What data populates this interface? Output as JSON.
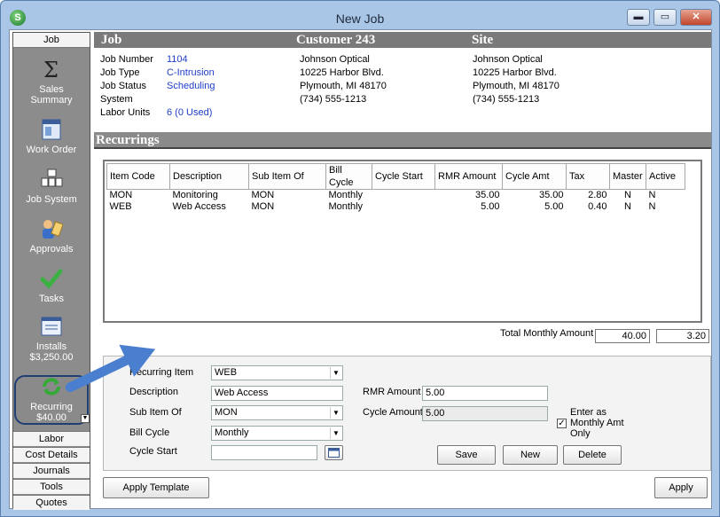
{
  "window": {
    "title": "New Job",
    "app_icon": "S",
    "min": "▬",
    "max": "▭",
    "close": "✕"
  },
  "nav": {
    "top": "Job",
    "items": [
      {
        "label": "Sales\nSummary"
      },
      {
        "label": "Work Order"
      },
      {
        "label": "Job System"
      },
      {
        "label": "Approvals"
      },
      {
        "label": "Tasks"
      },
      {
        "label": "Installs\n$3,250.00"
      },
      {
        "label": "Recurring\n$40.00"
      }
    ],
    "bottom": [
      "Labor",
      "Cost Details",
      "Journals",
      "Tools",
      "Quotes"
    ]
  },
  "header": {
    "job_heading": "Job",
    "customer_heading": "Customer 243",
    "site_heading": "Site",
    "fields": [
      {
        "label": "Job Number",
        "value": "1104"
      },
      {
        "label": "Job Type",
        "value": "C-Intrusion"
      },
      {
        "label": "Job Status",
        "value": "Scheduling"
      },
      {
        "label": "System",
        "value": ""
      },
      {
        "label": "Labor Units",
        "value": "6 (0 Used)"
      }
    ],
    "customer": [
      "Johnson Optical",
      "10225 Harbor Blvd.",
      "Plymouth, MI  48170",
      "(734) 555-1213"
    ],
    "site": [
      "Johnson Optical",
      "10225 Harbor Blvd.",
      "Plymouth, MI  48170",
      "(734) 555-1213"
    ]
  },
  "recurrings": {
    "title": "Recurrings",
    "columns": [
      "Item Code",
      "Description",
      "Sub Item Of",
      "Bill Cycle",
      "Cycle Start",
      "RMR Amount",
      "Cycle Amt",
      "Tax",
      "Master",
      "Active"
    ],
    "rows": [
      [
        "MON",
        "Monitoring",
        "MON",
        "Monthly",
        "",
        "35.00",
        "35.00",
        "2.80",
        "N",
        "N"
      ],
      [
        "WEB",
        "Web Access",
        "MON",
        "Monthly",
        "",
        "5.00",
        "5.00",
        "0.40",
        "N",
        "N"
      ]
    ],
    "total_label": "Total Monthly Amount",
    "total_amount": "40.00",
    "total_tax": "3.20"
  },
  "form": {
    "recurring_item_label": "Recurring Item",
    "recurring_item_value": "WEB",
    "description_label": "Description",
    "description_value": "Web Access",
    "sub_item_label": "Sub Item Of",
    "sub_item_value": "MON",
    "bill_cycle_label": "Bill Cycle",
    "bill_cycle_value": "Monthly",
    "cycle_start_label": "Cycle Start",
    "cycle_start_value": "",
    "rmr_amount_label": "RMR Amount",
    "rmr_amount_value": "5.00",
    "cycle_amount_label": "Cycle Amount",
    "cycle_amount_value": "5.00",
    "enter_as_monthly_label": "Enter as\nMonthly Amt\nOnly",
    "enter_as_monthly_checked": true,
    "save": "Save",
    "new": "New",
    "delete": "Delete"
  },
  "footer": {
    "apply_template": "Apply Template",
    "apply": "Apply"
  },
  "colors": {
    "accent": "#1f3ec8",
    "header_bar": "#7a7a7a",
    "nav_bg": "#8c8c8c",
    "callout": "#4a7fcf"
  }
}
